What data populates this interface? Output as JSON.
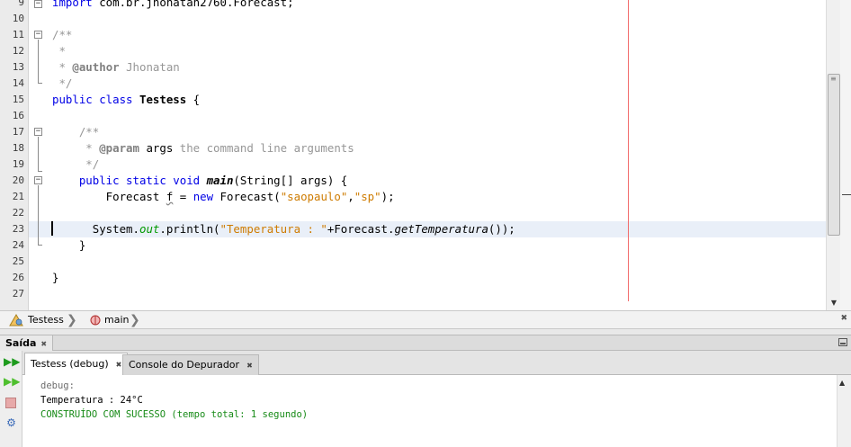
{
  "editor": {
    "lines": [
      {
        "num": "9",
        "segments": [
          {
            "t": "import ",
            "c": "kw"
          },
          {
            "t": "com.br.jhonatan2760.Forecast;",
            "c": ""
          }
        ]
      },
      {
        "num": "10",
        "segments": []
      },
      {
        "num": "11",
        "segments": [
          {
            "t": "/**",
            "c": "cm"
          }
        ]
      },
      {
        "num": "12",
        "segments": [
          {
            "t": " *",
            "c": "cm"
          }
        ]
      },
      {
        "num": "13",
        "segments": [
          {
            "t": " * ",
            "c": "cm"
          },
          {
            "t": "@author",
            "c": "tag"
          },
          {
            "t": " Jhonatan",
            "c": "cm"
          }
        ]
      },
      {
        "num": "14",
        "segments": [
          {
            "t": " */",
            "c": "cm"
          }
        ]
      },
      {
        "num": "15",
        "segments": [
          {
            "t": "public class ",
            "c": "kw"
          },
          {
            "t": "Testess",
            "c": "bold"
          },
          {
            "t": " {",
            "c": ""
          }
        ]
      },
      {
        "num": "16",
        "segments": []
      },
      {
        "num": "17",
        "segments": [
          {
            "t": "    /**",
            "c": "cm"
          }
        ]
      },
      {
        "num": "18",
        "segments": [
          {
            "t": "     * ",
            "c": "cm"
          },
          {
            "t": "@param",
            "c": "tag"
          },
          {
            "t": " args",
            "c": ""
          },
          {
            "t": " the command line arguments",
            "c": "cm"
          }
        ]
      },
      {
        "num": "19",
        "segments": [
          {
            "t": "     */",
            "c": "cm"
          }
        ]
      },
      {
        "num": "20",
        "segments": [
          {
            "t": "    public static void ",
            "c": "kw"
          },
          {
            "t": "main",
            "c": "mth"
          },
          {
            "t": "(String[] args) {",
            "c": ""
          }
        ]
      },
      {
        "num": "21",
        "segments": [
          {
            "t": "        Forecast ",
            "c": ""
          },
          {
            "t": "f",
            "c": "under"
          },
          {
            "t": " = ",
            "c": ""
          },
          {
            "t": "new",
            "c": "kw"
          },
          {
            "t": " Forecast(",
            "c": ""
          },
          {
            "t": "\"saopaulo\"",
            "c": "str"
          },
          {
            "t": ",",
            "c": ""
          },
          {
            "t": "\"sp\"",
            "c": "str"
          },
          {
            "t": ");",
            "c": ""
          }
        ]
      },
      {
        "num": "22",
        "segments": []
      },
      {
        "num": "23",
        "segments": [
          {
            "t": "      System.",
            "c": ""
          },
          {
            "t": "out",
            "c": "fld"
          },
          {
            "t": ".println(",
            "c": ""
          },
          {
            "t": "\"Temperatura : \"",
            "c": "str"
          },
          {
            "t": "+Forecast.",
            "c": ""
          },
          {
            "t": "getTemperatura",
            "c": "ital"
          },
          {
            "t": "());",
            "c": ""
          }
        ]
      },
      {
        "num": "24",
        "segments": [
          {
            "t": "    }",
            "c": ""
          }
        ]
      },
      {
        "num": "25",
        "segments": []
      },
      {
        "num": "26",
        "segments": [
          {
            "t": "}",
            "c": ""
          }
        ]
      },
      {
        "num": "27",
        "segments": []
      }
    ]
  },
  "breadcrumb": {
    "class_label": "Testess",
    "method_label": "main"
  },
  "output": {
    "panel_title": "Saída",
    "tabs": [
      {
        "label": "Testess (debug)",
        "active": true
      },
      {
        "label": "Console do Depurador",
        "active": false
      }
    ],
    "lines": [
      {
        "text": "debug:",
        "color": "#6e6e6e"
      },
      {
        "text": "Temperatura : 24°C",
        "color": "#000000"
      },
      {
        "text": "CONSTRUÍDO COM SUCESSO (tempo total: 1 segundo)",
        "color": "#168a16"
      }
    ]
  },
  "icons": {
    "class_icon": "class-icon",
    "method_icon": "method-icon",
    "rerun_icon": "rerun-icon",
    "rerun_with_options_icon": "rerun-options-icon",
    "stop_icon": "stop-icon",
    "settings_icon": "settings-icon"
  },
  "colors": {
    "keyword": "#0000e6",
    "comment": "#969696",
    "string": "#ce7b00",
    "field": "#009900",
    "current_line": "#e9eff8",
    "margin_line": "#f26b6b"
  }
}
